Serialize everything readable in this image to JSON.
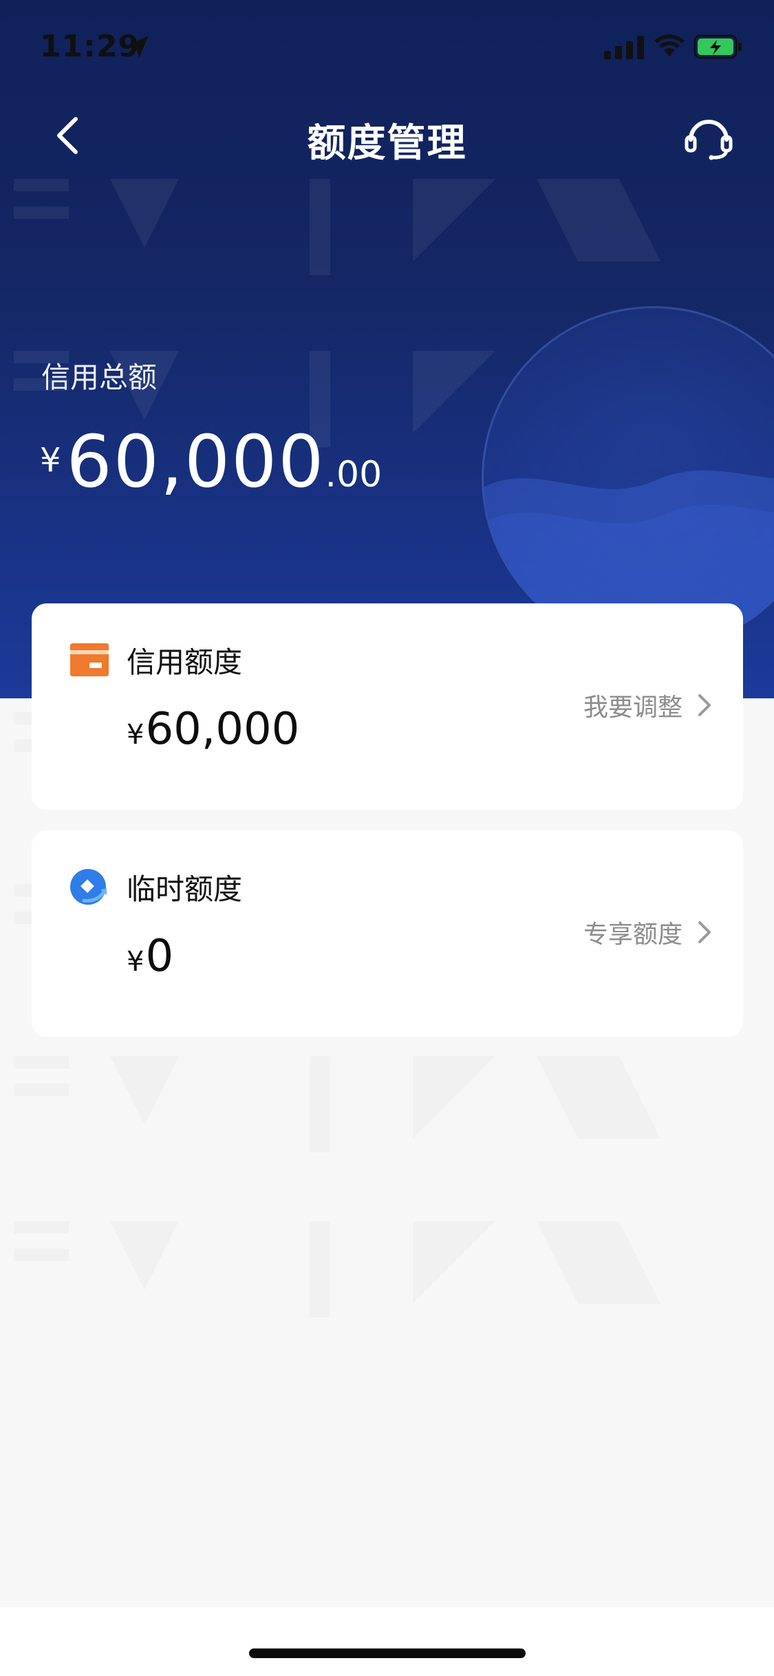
{
  "status_bar": {
    "time": "11:29"
  },
  "nav": {
    "title": "额度管理"
  },
  "total": {
    "label": "信用总额",
    "currency": "¥",
    "amount_integer": "60,000",
    "amount_decimal": ".00"
  },
  "cards": [
    {
      "title": "信用额度",
      "currency": "¥",
      "amount": "60,000",
      "link_text": "我要调整",
      "icon": "credit-card-icon",
      "icon_color": "#f07a2e"
    },
    {
      "title": "临时额度",
      "currency": "¥",
      "amount": "0",
      "link_text": "专享额度",
      "icon": "temp-credit-icon",
      "icon_color": "#2f7de8"
    }
  ],
  "colors": {
    "hero_top": "#10215a",
    "hero_bottom": "#1c3a9a",
    "page_bg": "#f7f7f8",
    "battery_green": "#34c759"
  }
}
